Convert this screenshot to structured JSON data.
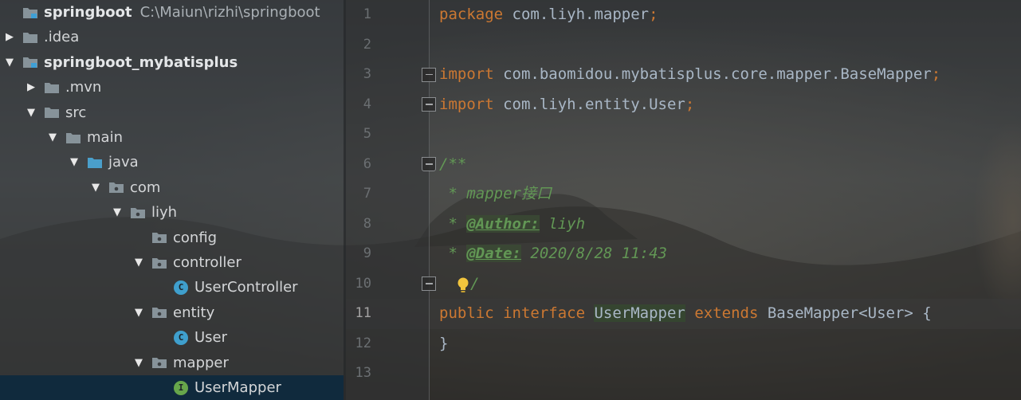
{
  "project_tree": [
    {
      "label": "springboot",
      "path": "C:\\Maiun\\rizhi\\springboot",
      "depth": 0,
      "arrow": "none",
      "icon": "module-icon",
      "bold": true
    },
    {
      "label": ".idea",
      "depth": 0,
      "arrow": "collapsed",
      "icon": "folder-icon"
    },
    {
      "label": "springboot_mybatisplus",
      "depth": 0,
      "arrow": "expanded",
      "icon": "module-icon",
      "bold": true
    },
    {
      "label": ".mvn",
      "depth": 1,
      "arrow": "collapsed",
      "icon": "folder-icon"
    },
    {
      "label": "src",
      "depth": 1,
      "arrow": "expanded",
      "icon": "folder-icon"
    },
    {
      "label": "main",
      "depth": 2,
      "arrow": "expanded",
      "icon": "folder-icon"
    },
    {
      "label": "java",
      "depth": 3,
      "arrow": "expanded",
      "icon": "source-folder-icon"
    },
    {
      "label": "com",
      "depth": 4,
      "arrow": "expanded",
      "icon": "package-icon"
    },
    {
      "label": "liyh",
      "depth": 5,
      "arrow": "expanded",
      "icon": "package-icon"
    },
    {
      "label": "config",
      "depth": 6,
      "arrow": "none",
      "icon": "package-icon"
    },
    {
      "label": "controller",
      "depth": 6,
      "arrow": "expanded",
      "icon": "package-icon"
    },
    {
      "label": "UserController",
      "depth": 7,
      "arrow": "none",
      "icon": "class-icon"
    },
    {
      "label": "entity",
      "depth": 6,
      "arrow": "expanded",
      "icon": "package-icon"
    },
    {
      "label": "User",
      "depth": 7,
      "arrow": "none",
      "icon": "class-icon"
    },
    {
      "label": "mapper",
      "depth": 6,
      "arrow": "expanded",
      "icon": "package-icon"
    },
    {
      "label": "UserMapper",
      "depth": 7,
      "arrow": "none",
      "icon": "interface-icon",
      "selected": true
    }
  ],
  "icon_glyphs": {
    "class_letter": "C",
    "interface_letter": "I"
  },
  "editor": {
    "current_line": 11,
    "line_numbers": [
      "1",
      "2",
      "3",
      "4",
      "5",
      "6",
      "7",
      "8",
      "9",
      "10",
      "11",
      "12",
      "13"
    ],
    "fold_lines": [
      3,
      4,
      6,
      10
    ],
    "lines": [
      {
        "n": 1,
        "tokens": [
          {
            "t": "package ",
            "c": "kw"
          },
          {
            "t": "com.liyh.mapper",
            "c": "plain"
          },
          {
            "t": ";",
            "c": "kw"
          }
        ]
      },
      {
        "n": 2,
        "tokens": []
      },
      {
        "n": 3,
        "tokens": [
          {
            "t": "import ",
            "c": "kw"
          },
          {
            "t": "com.baomidou.mybatisplus.core.mapper.BaseMapper",
            "c": "plain"
          },
          {
            "t": ";",
            "c": "kw"
          }
        ]
      },
      {
        "n": 4,
        "tokens": [
          {
            "t": "import ",
            "c": "kw"
          },
          {
            "t": "com.liyh.entity.User",
            "c": "plain"
          },
          {
            "t": ";",
            "c": "kw"
          }
        ]
      },
      {
        "n": 5,
        "tokens": []
      },
      {
        "n": 6,
        "tokens": [
          {
            "t": "/**",
            "c": "doc"
          }
        ]
      },
      {
        "n": 7,
        "tokens": [
          {
            "t": " * mapper接口",
            "c": "doc"
          }
        ]
      },
      {
        "n": 8,
        "tokens": [
          {
            "t": " * ",
            "c": "doc"
          },
          {
            "t": "@Author:",
            "c": "doc-tag"
          },
          {
            "t": " liyh",
            "c": "doc"
          }
        ]
      },
      {
        "n": 9,
        "tokens": [
          {
            "t": " * ",
            "c": "doc"
          },
          {
            "t": "@Date:",
            "c": "doc-tag"
          },
          {
            "t": " 2020/8/28 11:43",
            "c": "doc"
          }
        ]
      },
      {
        "n": 10,
        "tokens": [
          {
            "t": "bulb",
            "c": "bulb"
          },
          {
            "t": "/",
            "c": "doc"
          }
        ]
      },
      {
        "n": 11,
        "tokens": [
          {
            "t": "public ",
            "c": "kw"
          },
          {
            "t": "interface ",
            "c": "kw"
          },
          {
            "t": "UserMapper",
            "c": "ident-hl"
          },
          {
            "t": " ",
            "c": "plain"
          },
          {
            "t": "extends ",
            "c": "kw"
          },
          {
            "t": "BaseMapper<User> {",
            "c": "plain"
          }
        ]
      },
      {
        "n": 12,
        "tokens": [
          {
            "t": "}",
            "c": "plain"
          }
        ]
      },
      {
        "n": 13,
        "tokens": []
      }
    ]
  },
  "colors": {
    "keyword": "#cc7832",
    "identifier": "#a9b7c6",
    "doc_comment": "#629755",
    "selection": "#0d293e",
    "folder": "#87939a",
    "source_folder": "#4a9fcb"
  }
}
